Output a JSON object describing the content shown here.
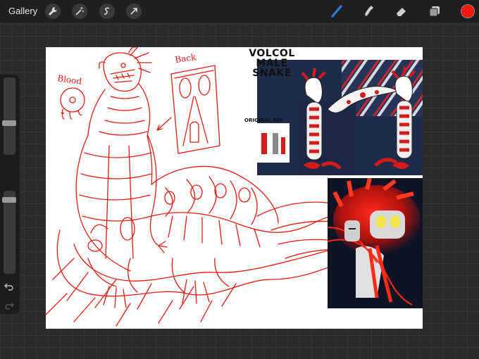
{
  "topbar": {
    "gallery_label": "Gallery",
    "left_tools": [
      "wrench-icon",
      "magic-wand-icon",
      "selection-icon",
      "transform-arrow-icon"
    ],
    "right_tools": [
      "brush-icon",
      "smudge-icon",
      "eraser-icon",
      "layers-icon"
    ],
    "active_tool": "brush",
    "current_color": "#ee1a0e"
  },
  "sidebar": {
    "brush_size_level": 0.5,
    "opacity_level": 0.95
  },
  "canvas": {
    "sketch_labels": {
      "blood": "Blood",
      "back": "Back"
    },
    "reference": {
      "title_line1": "VOLCOL",
      "title_line2": "MALE",
      "title_line3": "SNAKE",
      "original_ref": "ORIGINAL REF"
    },
    "sketch_color": "#e31b12"
  }
}
